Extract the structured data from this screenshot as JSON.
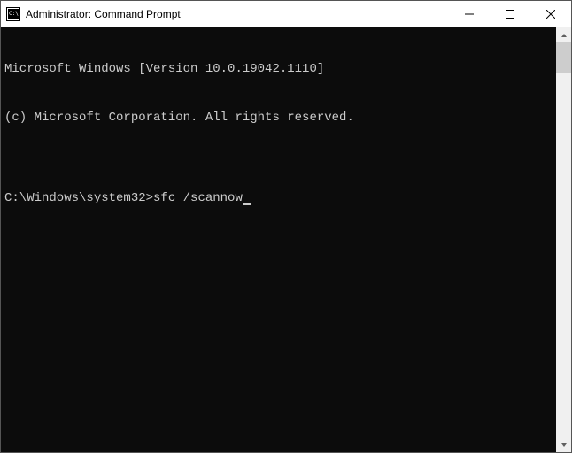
{
  "window": {
    "title": "Administrator: Command Prompt"
  },
  "terminal": {
    "line1": "Microsoft Windows [Version 10.0.19042.1110]",
    "line2": "(c) Microsoft Corporation. All rights reserved.",
    "blank": "",
    "prompt": "C:\\Windows\\system32>",
    "command": "sfc /scannow"
  }
}
